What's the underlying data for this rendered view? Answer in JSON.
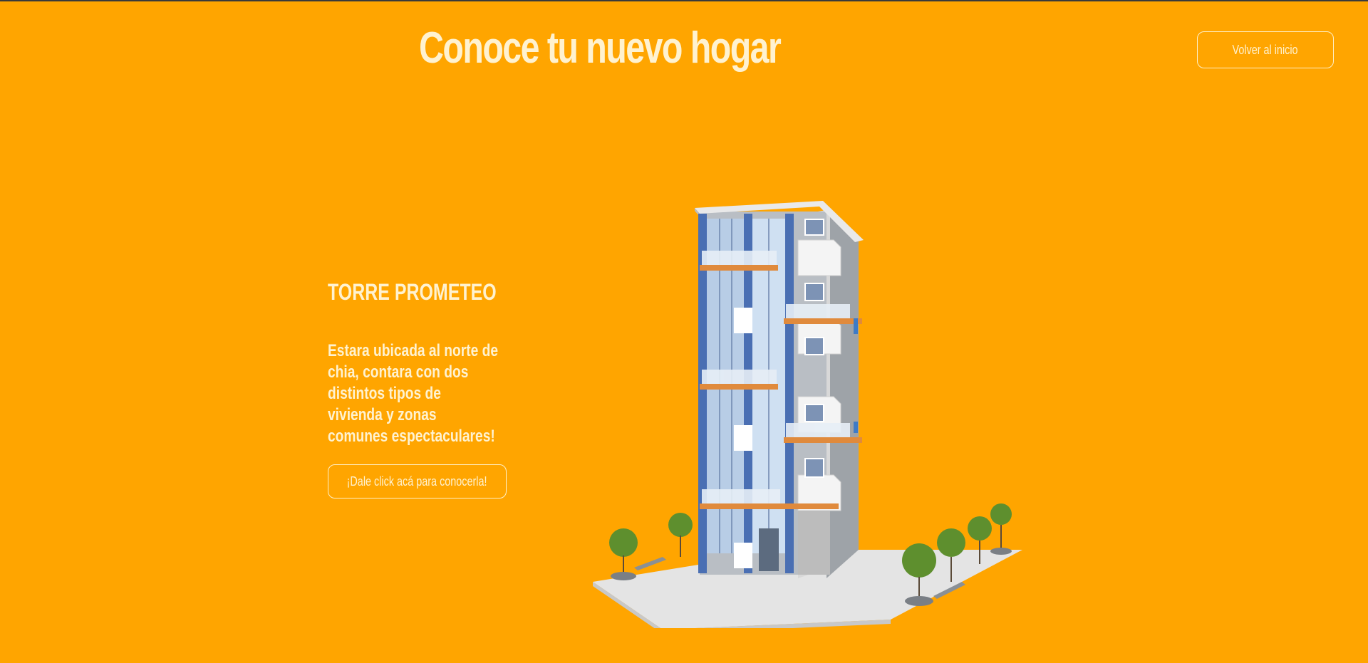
{
  "header": {
    "title": "Conoce tu nuevo hogar",
    "back_button_label": "Volver al inicio"
  },
  "project": {
    "name": "TORRE PROMETEO",
    "description": "Estara ubicada al norte de chia, contara con dos distintos tipos de vivienda y zonas comunes espectaculares!",
    "cta_label": "¡Dale click acá para conocerla!",
    "image_icon": "apartment-building-illustration"
  },
  "colors": {
    "background": "#FFA500",
    "text": "#FFF2D0",
    "building_blue": "#4A6FB3",
    "balcony_wood": "#E08A3C"
  }
}
